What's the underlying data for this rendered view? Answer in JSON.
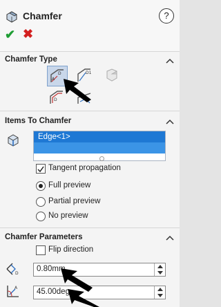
{
  "header": {
    "title": "Chamfer",
    "help": "?",
    "ok_icon": "checkmark-icon",
    "cancel_icon": "x-icon"
  },
  "chamfer_type": {
    "title": "Chamfer Type",
    "buttons": [
      "angle-distance-icon",
      "distance-distance-icon",
      "vertex-icon",
      "offset-face-icon",
      "face-face-icon"
    ]
  },
  "items": {
    "title": "Items To Chamfer",
    "list": [
      "Edge<1>"
    ],
    "tangent_propagation": "Tangent propagation",
    "full_preview": "Full preview",
    "partial_preview": "Partial preview",
    "no_preview": "No preview"
  },
  "params": {
    "title": "Chamfer Parameters",
    "flip_direction": "Flip direction",
    "distance": "0.80mm",
    "angle": "45.00deg"
  },
  "colors": {
    "ok": "#1f9d34",
    "cancel": "#d32020",
    "selection": "#1e78d4"
  }
}
